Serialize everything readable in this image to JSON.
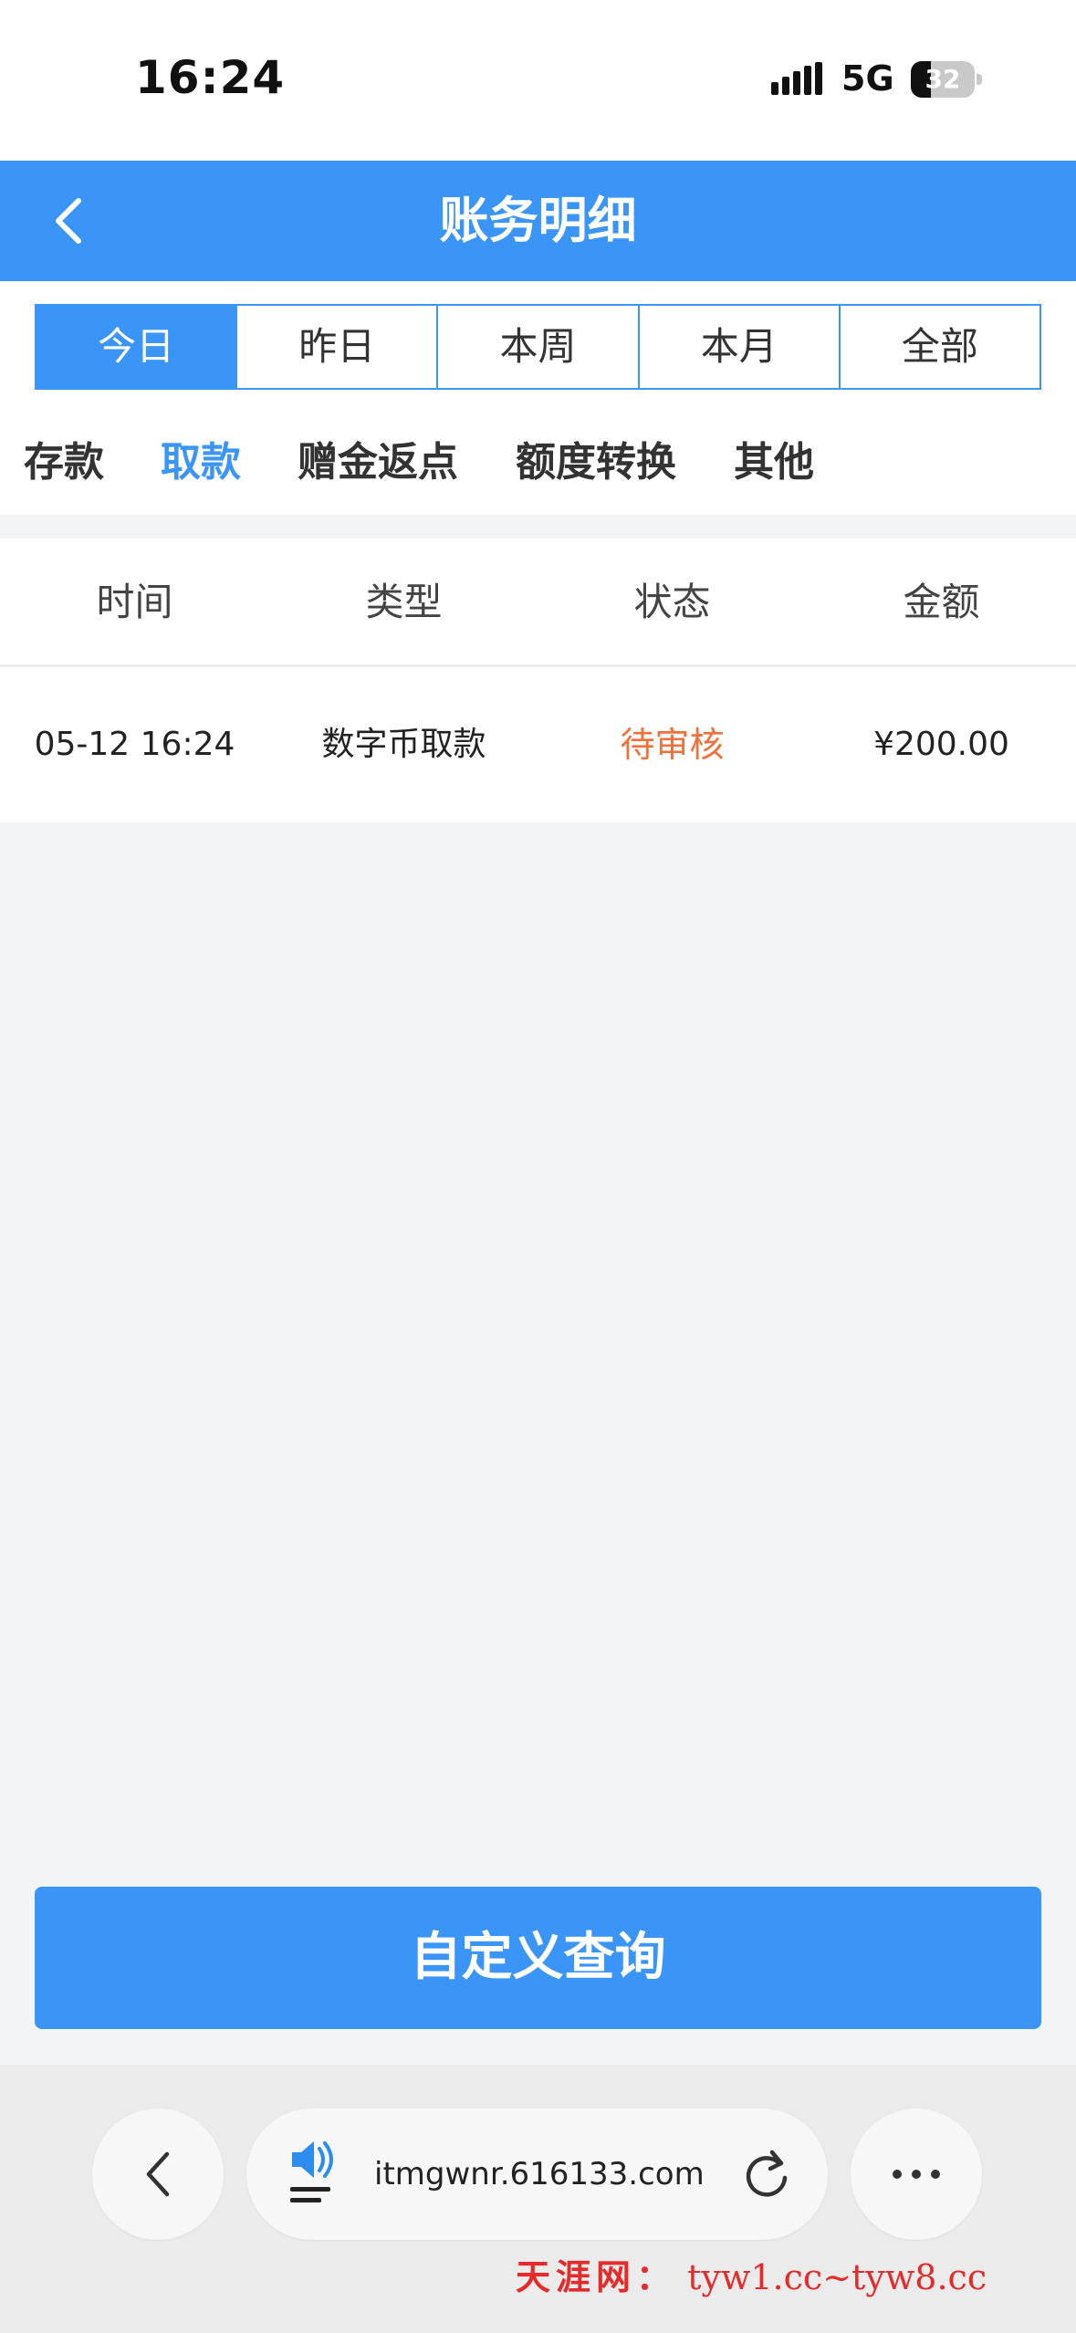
{
  "status_bar": {
    "time": "16:24",
    "network": "5G",
    "battery": "32",
    "battery_level": 0.32
  },
  "nav": {
    "title": "账务明细",
    "back_icon": "chevron-left-icon"
  },
  "period_tabs": [
    {
      "label": "今日",
      "active": true
    },
    {
      "label": "昨日",
      "active": false
    },
    {
      "label": "本周",
      "active": false
    },
    {
      "label": "本月",
      "active": false
    },
    {
      "label": "全部",
      "active": false
    }
  ],
  "category_tabs": [
    {
      "label": "存款",
      "active": false
    },
    {
      "label": "取款",
      "active": true
    },
    {
      "label": "赠金返点",
      "active": false
    },
    {
      "label": "额度转换",
      "active": false
    },
    {
      "label": "其他",
      "active": false
    }
  ],
  "table": {
    "headers": [
      "时间",
      "类型",
      "状态",
      "金额"
    ],
    "rows": [
      {
        "time": "05-12 16:24",
        "type": "数字币取款",
        "status": "待审核",
        "amount": "¥200.00"
      }
    ]
  },
  "query_button": {
    "label": "自定义查询"
  },
  "browser": {
    "url": "itmgwnr.616133.com",
    "icons": [
      "chevron-left-icon",
      "speaker-icon",
      "reload-icon",
      "more-icon"
    ]
  },
  "watermark": {
    "cn": "天涯网：",
    "url": "tyw1.cc~tyw8.cc"
  },
  "colors": {
    "accent": "#3a95f7",
    "pending": "#f2713a",
    "background": "#f3f4f6"
  }
}
